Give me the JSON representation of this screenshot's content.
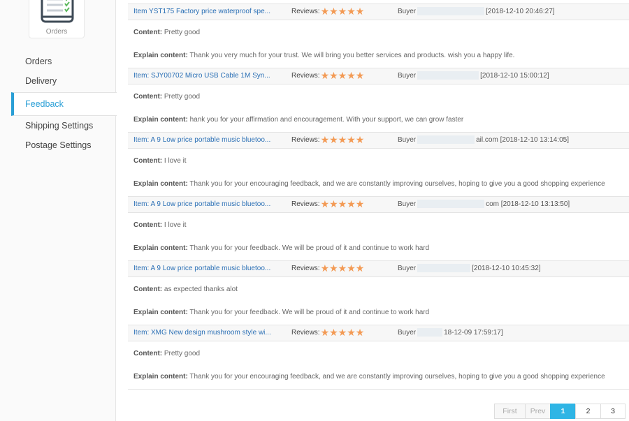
{
  "sidebar": {
    "module_label": "Orders",
    "items": [
      {
        "label": "Orders"
      },
      {
        "label": "Delivery"
      },
      {
        "label": "Feedback"
      },
      {
        "label": "Shipping Settings"
      },
      {
        "label": "Postage Settings"
      }
    ],
    "active_index": 2
  },
  "labels": {
    "reviews": "Reviews:",
    "buyer": "Buyer",
    "content": "Content:",
    "explain": "Explain content:"
  },
  "stars_glyph": "★★★★★",
  "feedback": [
    {
      "item": "Item YST175 Factory price waterproof spe...",
      "buyer_tail": "[2018-12-10 20:46:27]",
      "content": "Pretty good",
      "explain": "Thank you very much for your trust. We will bring you better services and products. wish you a happy life."
    },
    {
      "item": "Item: SJY00702 Micro USB Cable 1M Syn...",
      "buyer_tail": "[2018-12-10 15:00:12]",
      "content": "Pretty good",
      "explain": "hank you for your affirmation and encouragement. With your support, we can grow faster"
    },
    {
      "item": "Item: A 9 Low price portable music bluetoo...",
      "buyer_tail": "ail.com [2018-12-10 13:14:05]",
      "content": "I love it",
      "explain": "Thank you for your encouraging feedback, and we are constantly improving ourselves, hoping to give you a good shopping experience"
    },
    {
      "item": "Item: A 9 Low price portable music bluetoo...",
      "buyer_tail": "com [2018-12-10 13:13:50]",
      "content": "I love it",
      "explain": "Thank you for your feedback. We will be proud of it and continue to work hard"
    },
    {
      "item": "Item: A 9 Low price portable music bluetoo...",
      "buyer_tail": "[2018-12-10 10:45:32]",
      "content": "as expected thanks alot",
      "explain": "Thank you for your feedback. We will be proud of it and continue to work hard"
    },
    {
      "item": "Item: XMG New design mushroom style wi...",
      "buyer_tail": "18-12-09 17:59:17]",
      "content": "Pretty good",
      "explain": "Thank you for your encouraging feedback, and we are constantly improving ourselves, hoping to give you a good shopping experience"
    }
  ],
  "pagination": {
    "first": "First",
    "prev": "Prev",
    "pages": [
      "1",
      "2",
      "3"
    ],
    "current": "1"
  },
  "colors": {
    "accent": "#2a9fd6",
    "link": "#2a6fb5",
    "star": "#f39a54",
    "current_page": "#2fb5e5"
  }
}
